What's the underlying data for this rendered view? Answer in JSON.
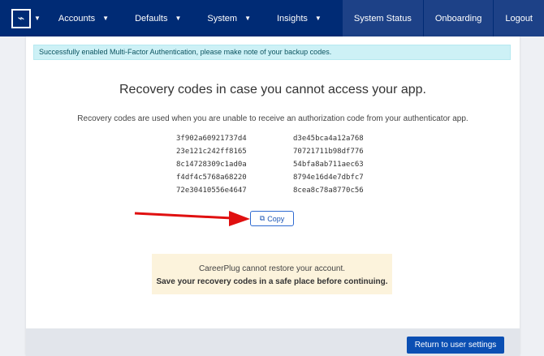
{
  "nav": {
    "items": [
      "Accounts",
      "Defaults",
      "System",
      "Insights"
    ],
    "right": [
      "System Status",
      "Onboarding",
      "Logout"
    ]
  },
  "alert": "Successfully enabled Multi-Factor Authentication, please make note of your backup codes.",
  "title": "Recovery codes in case you cannot access your app.",
  "description": "Recovery codes are used when you are unable to receive an authorization code from your authenticator app.",
  "codes": [
    "3f902a60921737d4",
    "d3e45bca4a12a768",
    "23e121c242ff8165",
    "70721711b98df776",
    "8c14728309c1ad0a",
    "54bfa8ab711aec63",
    "f4df4c5768a68220",
    "8794e16d4e7dbfc7",
    "72e30410556e4647",
    "8cea8c78a8770c56"
  ],
  "copy_label": "Copy",
  "warning": {
    "line1": "CareerPlug cannot restore your account.",
    "line2": "Save your recovery codes in a safe place before continuing."
  },
  "return_label": "Return to user settings"
}
